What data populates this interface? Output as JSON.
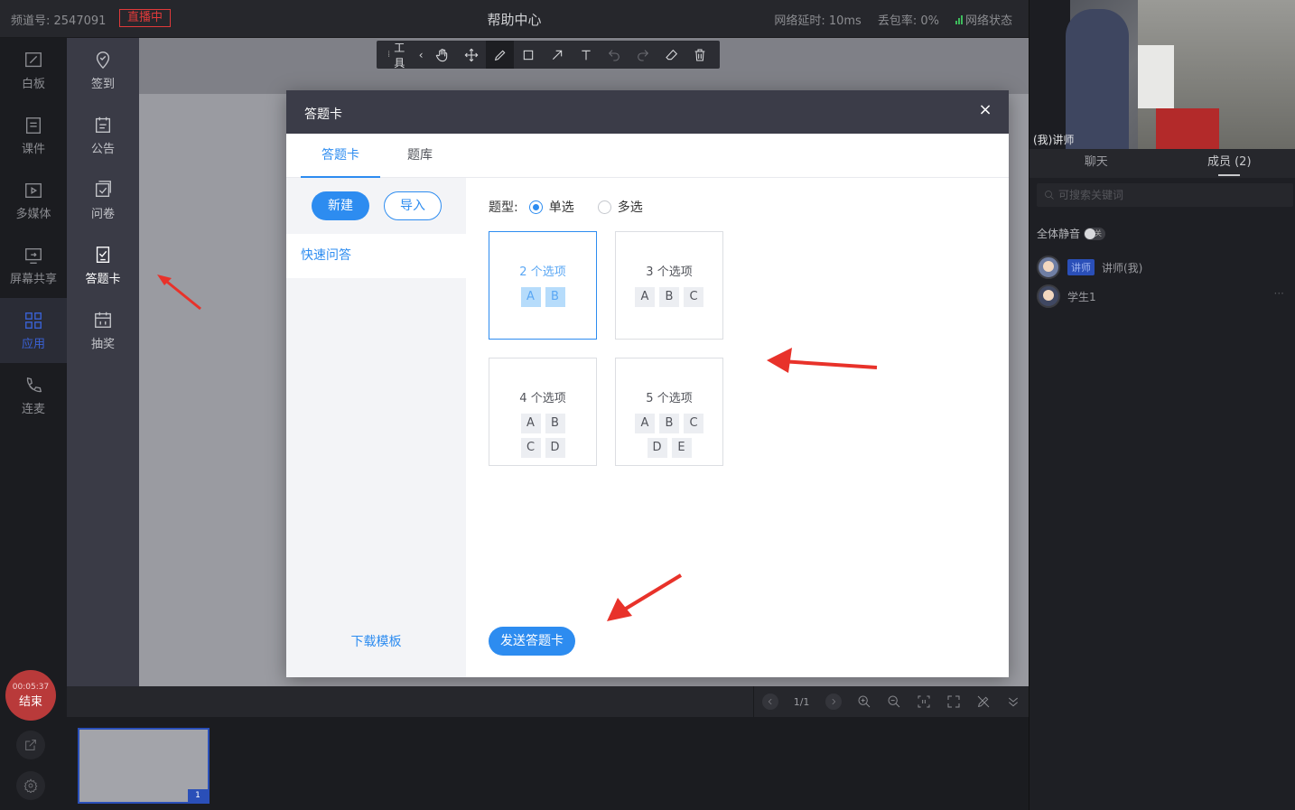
{
  "topbar": {
    "channel": "频道号: 2547091",
    "live_badge": "直播中",
    "title": "帮助中心",
    "latency": "网络延时: 10ms",
    "packet_loss": "丢包率: 0%",
    "network_status": "网络状态"
  },
  "left_nav": [
    {
      "label": "白板",
      "icon": "whiteboard-icon"
    },
    {
      "label": "课件",
      "icon": "courseware-icon"
    },
    {
      "label": "多媒体",
      "icon": "media-icon"
    },
    {
      "label": "屏幕共享",
      "icon": "screen-share-icon"
    },
    {
      "label": "应用",
      "icon": "apps-icon",
      "active": true
    },
    {
      "label": "连麦",
      "icon": "phone-icon"
    }
  ],
  "app_nav": [
    {
      "label": "签到",
      "icon": "check-in-icon"
    },
    {
      "label": "公告",
      "icon": "notice-icon"
    },
    {
      "label": "问卷",
      "icon": "survey-icon"
    },
    {
      "label": "答题卡",
      "icon": "answer-card-icon",
      "active": true
    },
    {
      "label": "抽奖",
      "icon": "lottery-icon"
    }
  ],
  "toolbar": {
    "label": "工具",
    "tools": [
      "hand-icon",
      "move-icon",
      "pen-icon",
      "rectangle-icon",
      "arrow-icon",
      "text-icon",
      "undo-icon",
      "redo-icon",
      "eraser-icon",
      "trash-icon"
    ]
  },
  "modal": {
    "title": "答题卡",
    "close": "×",
    "tabs": [
      "答题卡",
      "题库"
    ],
    "new_button": "新建",
    "import_button": "导入",
    "quick_item": "快速问答",
    "download_template": "下载模板",
    "type_label": "题型:",
    "type_single": "单选",
    "type_multi": "多选",
    "selected_type": "单选",
    "cards": [
      {
        "title": "2 个选项",
        "options": [
          "A",
          "B"
        ],
        "selected": true
      },
      {
        "title": "3 个选项",
        "options": [
          "A",
          "B",
          "C"
        ]
      },
      {
        "title": "4 个选项",
        "options": [
          "A",
          "B",
          "C",
          "D"
        ]
      },
      {
        "title": "5 个选项",
        "options": [
          "A",
          "B",
          "C",
          "D",
          "E"
        ]
      }
    ],
    "send_button": "发送答题卡"
  },
  "page_nav": {
    "page": "1/1"
  },
  "thumbnail": {
    "number": "1"
  },
  "end_control": {
    "time": "00:05:37",
    "label": "结束"
  },
  "right_panel": {
    "video_label": "(我)讲师",
    "tabs": [
      "聊天",
      "成员 (2)"
    ],
    "active_tab": "成员 (2)",
    "search_placeholder": "可搜索关键词",
    "mute_all": "全体静音",
    "mute_toggle": "关",
    "members": [
      {
        "badge": "讲师",
        "name": "讲师(我)"
      },
      {
        "badge": "",
        "name": "学生1"
      }
    ]
  },
  "colors": {
    "accent": "#2d8cf0",
    "live": "#e03a3a",
    "annotation_arrow": "#e8322a"
  }
}
